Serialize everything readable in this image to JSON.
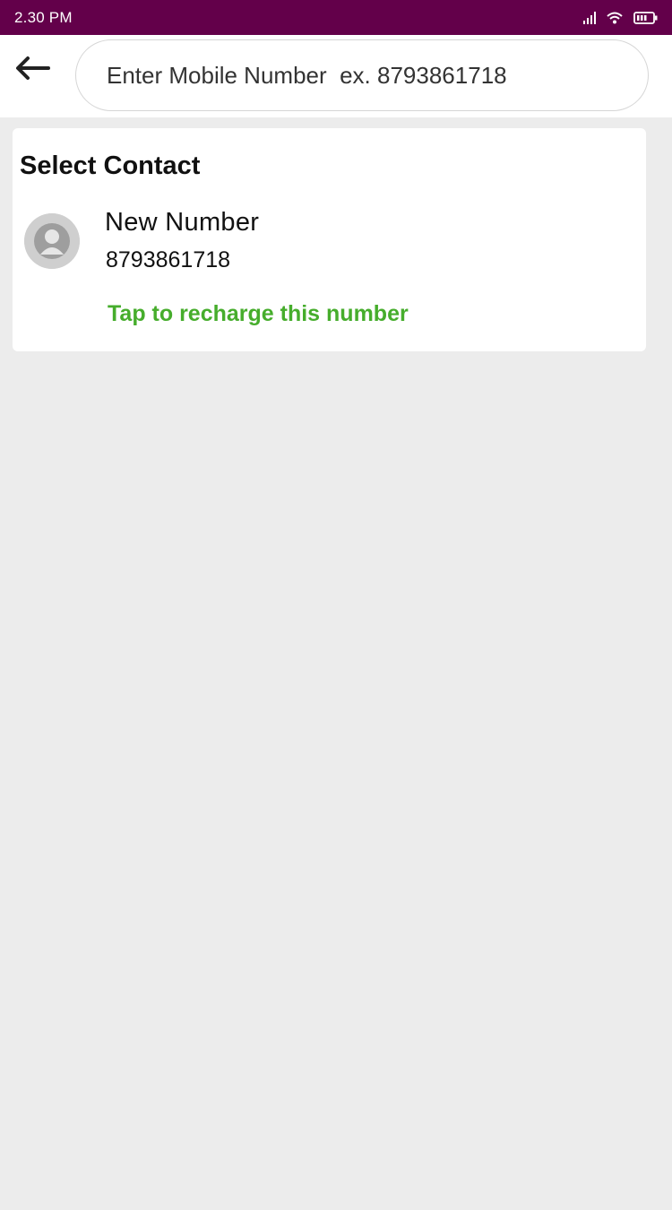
{
  "status_bar": {
    "time": "2.30 PM",
    "icons": [
      "signal-icon",
      "wifi-icon",
      "battery-icon"
    ],
    "background": "#63004a"
  },
  "header": {
    "back_icon": "back-arrow-icon",
    "search": {
      "placeholder": "Enter Mobile Number  ex. 8793861718",
      "value": ""
    }
  },
  "contacts": {
    "title": "Select Contact",
    "items": [
      {
        "name": "New Number",
        "number": "8793861718",
        "action": "Tap to recharge this number",
        "avatar_icon": "avatar-placeholder-icon"
      }
    ]
  },
  "colors": {
    "accent_green": "#46ad2c",
    "page_background": "#ececec"
  }
}
